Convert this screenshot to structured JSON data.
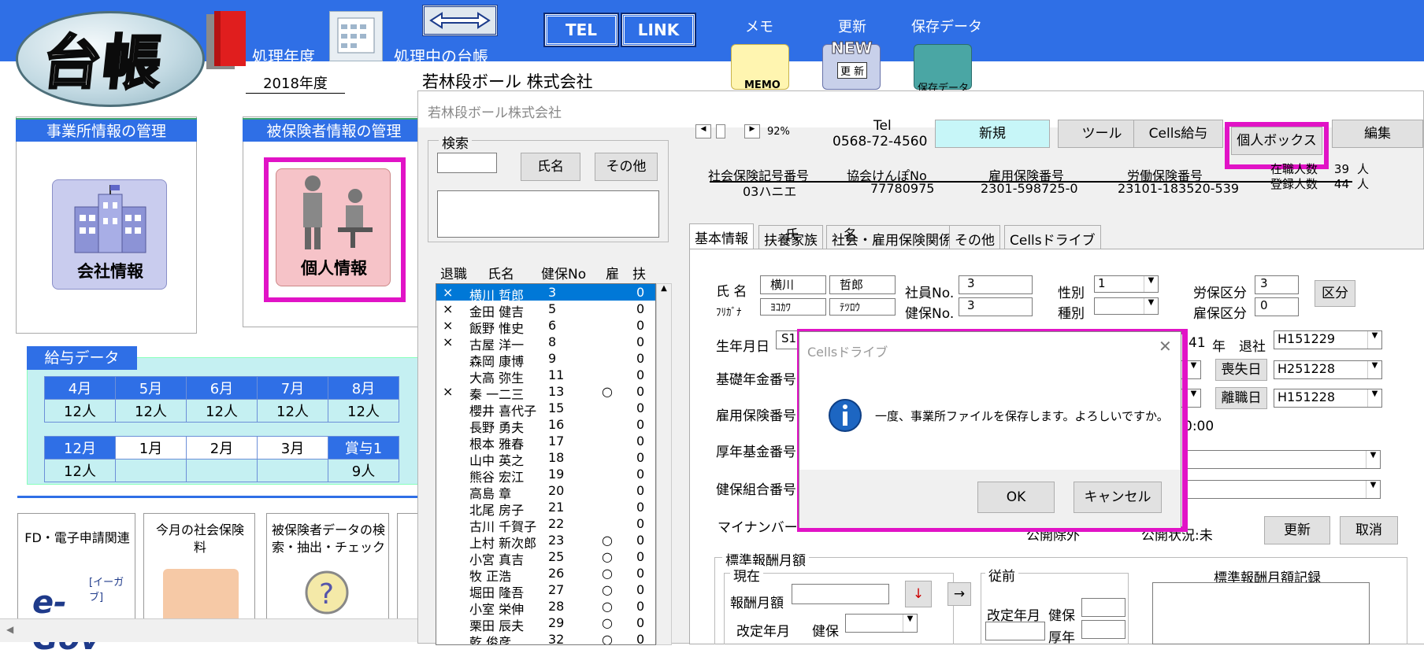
{
  "app": {
    "logo_text": "台帳",
    "labels": {
      "year": "処理年度",
      "ledger": "処理中の台帳",
      "memo": "メモ",
      "update": "更新",
      "saved": "保存データ"
    },
    "tel_button": "TEL",
    "link_button": "LINK",
    "memo_icon_text": "MEMO",
    "new_icon_text": "NEW",
    "update_icon_text": "更 新",
    "saved_icon_text": "保存データ",
    "year_value": "2018年度",
    "ledger_value": "若林段ボール 株式会社"
  },
  "panels": {
    "office": {
      "title": "事業所情報の管理",
      "button": "会社情報"
    },
    "insured": {
      "title": "被保険者情報の管理",
      "button": "個人情報"
    }
  },
  "salary": {
    "title": "給与データ",
    "row1_months": [
      "4月",
      "5月",
      "6月",
      "7月",
      "8月"
    ],
    "row1_values": [
      "12人",
      "12人",
      "12人",
      "12人",
      "12人"
    ],
    "row2_months": [
      "12月",
      "1月",
      "2月",
      "3月",
      "賞与1"
    ],
    "row2_values": [
      "12人",
      "",
      "",
      "",
      "9人"
    ]
  },
  "cards": [
    {
      "title": "FD・電子申請関連",
      "sub": "e-Gov",
      "sub2": "[イーガブ]"
    },
    {
      "title": "今月の社会保険料"
    },
    {
      "title": "被保険者データの検索・抽出・チェック"
    }
  ],
  "win": {
    "title": "若林段ボール株式会社",
    "search": {
      "label": "検索",
      "name_btn": "氏名",
      "other_btn": "その他"
    },
    "zoom": "92%",
    "tel_label": "Tel",
    "tel_value": "0568-72-4560",
    "buttons": {
      "new": "新規",
      "tool": "ツール",
      "cells_pay": "Cells給与",
      "personal_box": "個人ボックス",
      "edit": "編集"
    },
    "headers": [
      {
        "label": "社会保険記号番号",
        "value": "03ハニエ"
      },
      {
        "label": "協会けんぽNo",
        "value": "77780975"
      },
      {
        "label": "雇用保険番号",
        "value": "2301-598725-0"
      },
      {
        "label": "労働保険番号",
        "value": "23101-183520-539"
      }
    ],
    "counts": {
      "employed_label": "在職人数",
      "employed": "39",
      "registered_label": "登録人数",
      "registered": "44",
      "unit": "人"
    },
    "list_headers": [
      "退職",
      "氏名",
      "健保No",
      "雇",
      "扶"
    ],
    "employees": [
      {
        "ret": "×",
        "name": "横川 哲郎",
        "no": "3",
        "koyo": "",
        "fu": "0"
      },
      {
        "ret": "×",
        "name": "金田 健吉",
        "no": "5",
        "koyo": "",
        "fu": "0"
      },
      {
        "ret": "×",
        "name": "飯野 惟史",
        "no": "6",
        "koyo": "",
        "fu": "0"
      },
      {
        "ret": "×",
        "name": "古屋 洋一",
        "no": "8",
        "koyo": "",
        "fu": "0"
      },
      {
        "ret": "",
        "name": "森岡 康博",
        "no": "9",
        "koyo": "",
        "fu": "0"
      },
      {
        "ret": "",
        "name": "大高 弥生",
        "no": "11",
        "koyo": "",
        "fu": "0"
      },
      {
        "ret": "×",
        "name": "秦 一二三",
        "no": "13",
        "koyo": "○",
        "fu": "0"
      },
      {
        "ret": "",
        "name": "櫻井 喜代子",
        "no": "15",
        "koyo": "",
        "fu": "0"
      },
      {
        "ret": "",
        "name": "長野 勇夫",
        "no": "16",
        "koyo": "",
        "fu": "0"
      },
      {
        "ret": "",
        "name": "根本 雅春",
        "no": "17",
        "koyo": "",
        "fu": "0"
      },
      {
        "ret": "",
        "name": "山中 英之",
        "no": "18",
        "koyo": "",
        "fu": "0"
      },
      {
        "ret": "",
        "name": "熊谷 宏江",
        "no": "19",
        "koyo": "",
        "fu": "0"
      },
      {
        "ret": "",
        "name": "高島 章",
        "no": "20",
        "koyo": "",
        "fu": "0"
      },
      {
        "ret": "",
        "name": "北尾 房子",
        "no": "21",
        "koyo": "",
        "fu": "0"
      },
      {
        "ret": "",
        "name": "古川 千賀子",
        "no": "22",
        "koyo": "",
        "fu": "0"
      },
      {
        "ret": "",
        "name": "上村 新次郎",
        "no": "23",
        "koyo": "○",
        "fu": "0"
      },
      {
        "ret": "",
        "name": "小宮 真吉",
        "no": "25",
        "koyo": "○",
        "fu": "0"
      },
      {
        "ret": "",
        "name": "牧 正浩",
        "no": "26",
        "koyo": "○",
        "fu": "0"
      },
      {
        "ret": "",
        "name": "堀田 隆吾",
        "no": "27",
        "koyo": "○",
        "fu": "0"
      },
      {
        "ret": "",
        "name": "小室 栄伸",
        "no": "28",
        "koyo": "○",
        "fu": "0"
      },
      {
        "ret": "",
        "name": "栗田 辰夫",
        "no": "29",
        "koyo": "○",
        "fu": "0"
      },
      {
        "ret": "",
        "name": "乾 俊彦",
        "no": "32",
        "koyo": "○",
        "fu": "0"
      }
    ],
    "tabs": [
      "基本情報",
      "扶養家族",
      "社会・雇用保険関係",
      "その他",
      "Cellsドライブ"
    ],
    "form": {
      "sei": "氏",
      "mei": "名",
      "name_label": "氏 名",
      "furigana_label": "ﾌﾘｶﾞﾅ",
      "last_name": "横川",
      "first_name": "哲郎",
      "last_kana": "ﾖｺｶﾜ",
      "first_kana": "ﾃﾂﾛｳ",
      "emp_no_label": "社員No.",
      "emp_no": "3",
      "health_no_label": "健保No.",
      "health_no": "3",
      "gender_label": "性別",
      "gender": "1",
      "type_label": "種別",
      "type": "",
      "labor_label": "労保区分",
      "labor": "3",
      "employ_label": "雇保区分",
      "employ": "0",
      "kubun_btn": "区分",
      "birth_label": "生年月日",
      "birth_value": "S1",
      "age_unit": "41",
      "age_suffix": "年",
      "retire_label": "退社",
      "retire_date": "H151229",
      "loss_btn": "喪失日",
      "loss_date": "H251228",
      "leave_btn": "離職日",
      "leave_date": "H151228",
      "time_value": "0:00",
      "basic_pension": "基礎年金番号",
      "employment_ins": "雇用保険番号",
      "welfare_fund": "厚年基金番号",
      "health_union": "健保組合番号",
      "mynumber": "マイナンバー",
      "public_exclude": "公開除外",
      "public_status": "公開状況:未",
      "update_btn": "更新",
      "cancel_btn": "取消",
      "standard_title": "標準報酬月額",
      "current": "現在",
      "previous": "従前",
      "record_title": "標準報酬月額記録",
      "pay_monthly": "報酬月額",
      "revision": "改定年月",
      "health": "健保",
      "pension": "厚年"
    }
  },
  "dialog": {
    "title": "Cellsドライブ",
    "message": "一度、事業所ファイルを保存します。よろしいですか。",
    "ok": "OK",
    "cancel": "キャンセル"
  }
}
